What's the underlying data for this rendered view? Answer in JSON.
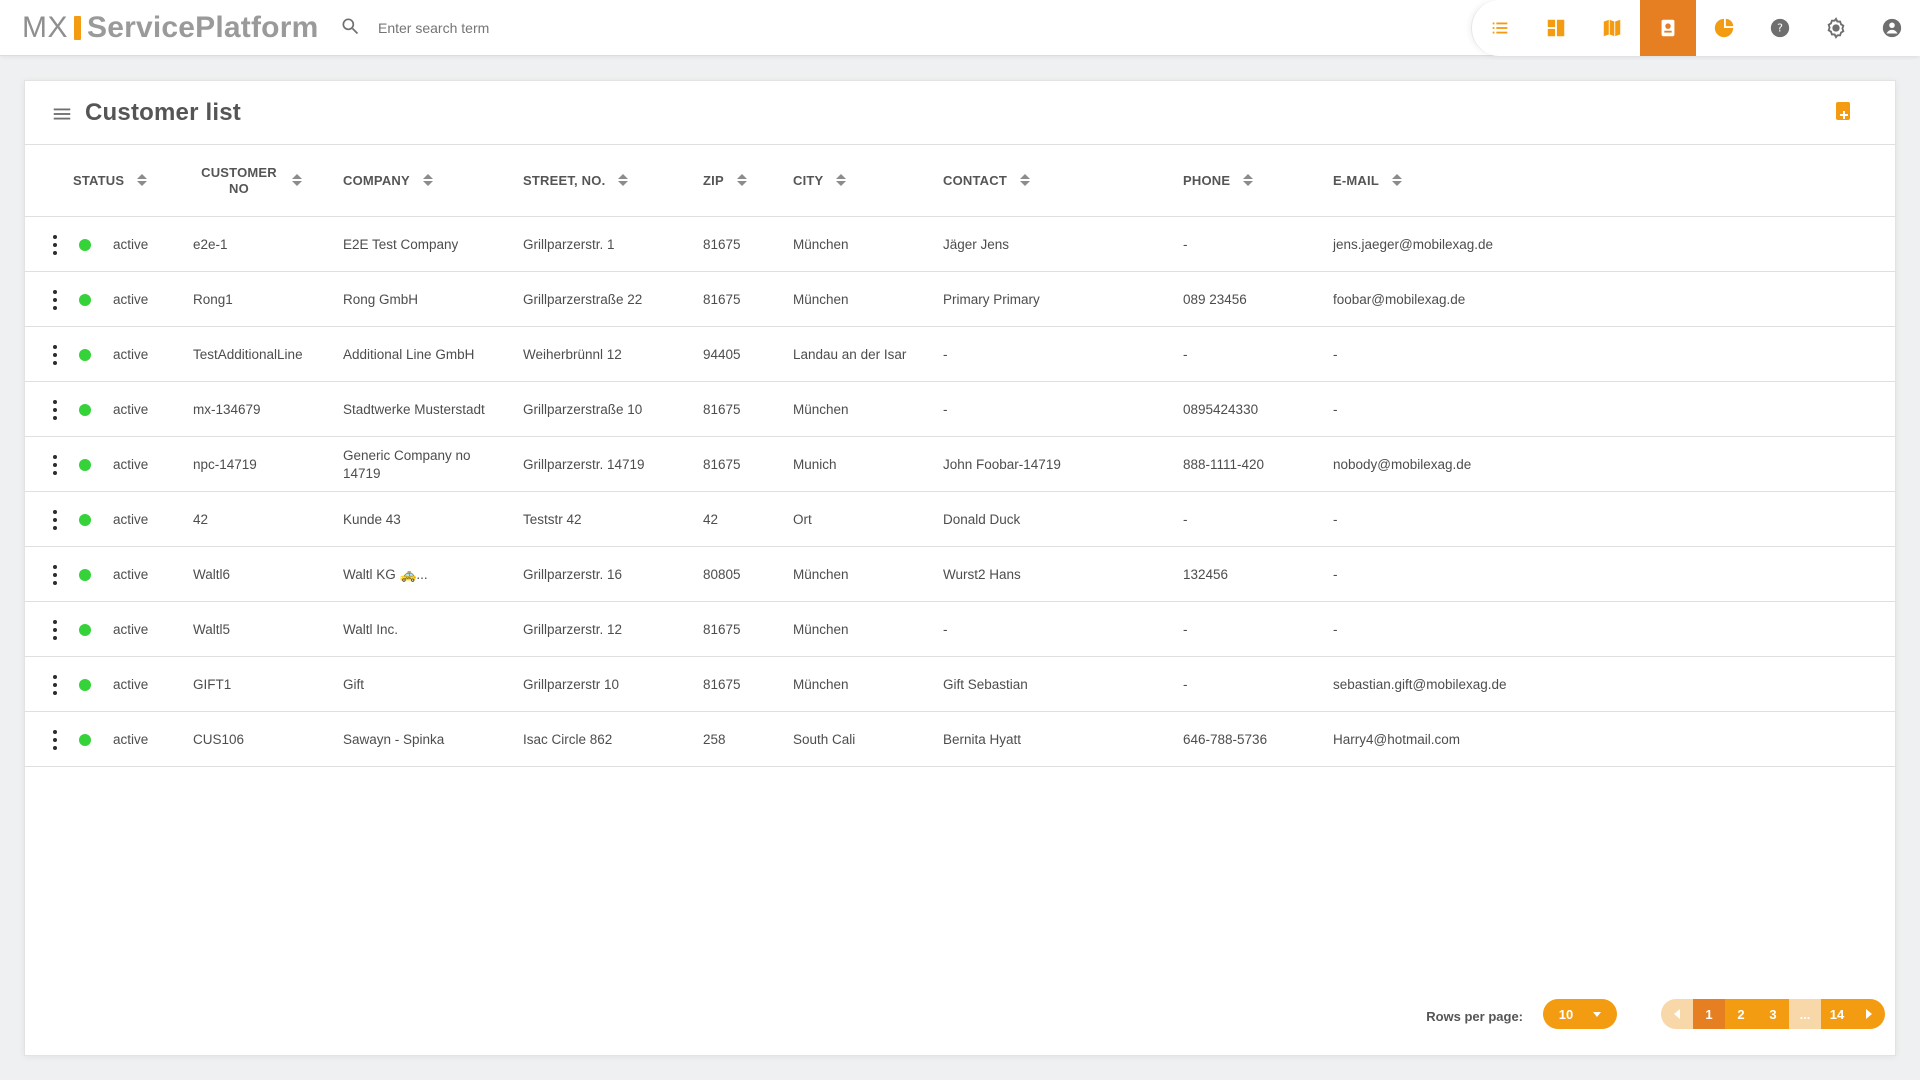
{
  "app": {
    "logo_mx": "MX",
    "logo_name": "ServicePlatform"
  },
  "search": {
    "placeholder": "Enter search term"
  },
  "toolbar": {
    "icons": [
      {
        "name": "list-icon",
        "color": "#F39C12"
      },
      {
        "name": "dashboard-icon",
        "color": "#F39C12"
      },
      {
        "name": "map-icon",
        "color": "#F39C12"
      },
      {
        "name": "contact-card-icon",
        "color": "#FFFFFF",
        "active": true
      },
      {
        "name": "pie-chart-icon",
        "color": "#F39C12"
      },
      {
        "name": "help-icon",
        "color": "#6F6F6F"
      },
      {
        "name": "settings-icon",
        "color": "#6F6F6F"
      },
      {
        "name": "account-icon",
        "color": "#6F6F6F"
      }
    ]
  },
  "page": {
    "title": "Customer list"
  },
  "table": {
    "columns": [
      {
        "key": "status",
        "label": "STATUS"
      },
      {
        "key": "customer_no",
        "label": "CUSTOMER NO"
      },
      {
        "key": "company",
        "label": "COMPANY"
      },
      {
        "key": "street",
        "label": "STREET, NO."
      },
      {
        "key": "zip",
        "label": "ZIP"
      },
      {
        "key": "city",
        "label": "CITY"
      },
      {
        "key": "contact",
        "label": "CONTACT"
      },
      {
        "key": "phone",
        "label": "PHONE"
      },
      {
        "key": "email",
        "label": "E-MAIL"
      }
    ],
    "rows": [
      {
        "status": "active",
        "customer_no": "e2e-1",
        "company": "E2E Test Company",
        "street": "Grillparzerstr. 1",
        "zip": "81675",
        "city": "München",
        "contact": "Jäger Jens",
        "phone": "-",
        "email": "jens.jaeger@mobilexag.de"
      },
      {
        "status": "active",
        "customer_no": "Rong1",
        "company": "Rong GmbH",
        "street": "Grillparzerstraße 22",
        "zip": "81675",
        "city": "München",
        "contact": "Primary Primary",
        "phone": "089 23456",
        "email": "foobar@mobilexag.de"
      },
      {
        "status": "active",
        "customer_no": "TestAdditionalLine",
        "company": "Additional Line GmbH",
        "street": "Weiherbrünnl 12",
        "zip": "94405",
        "city": "Landau an der Isar",
        "contact": "-",
        "phone": "-",
        "email": "-"
      },
      {
        "status": "active",
        "customer_no": "mx-134679",
        "company": "Stadtwerke Musterstadt",
        "street": "Grillparzerstraße 10",
        "zip": "81675",
        "city": "München",
        "contact": "-",
        "phone": "0895424330",
        "email": "-"
      },
      {
        "status": "active",
        "customer_no": "npc-14719",
        "company": "Generic Company no 14719",
        "street": "Grillparzerstr. 14719",
        "zip": "81675",
        "city": "Munich",
        "contact": "John Foobar-14719",
        "phone": "888-1111-420",
        "email": "nobody@mobilexag.de"
      },
      {
        "status": "active",
        "customer_no": "42",
        "company": "Kunde 43",
        "street": "Teststr 42",
        "zip": "42",
        "city": "Ort",
        "contact": "Donald Duck",
        "phone": "-",
        "email": "-"
      },
      {
        "status": "active",
        "customer_no": "Waltl6",
        "company": "Waltl KG 🚕...",
        "street": "Grillparzerstr. 16",
        "zip": "80805",
        "city": "München",
        "contact": "Wurst2 Hans",
        "phone": "132456",
        "email": "-"
      },
      {
        "status": "active",
        "customer_no": "Waltl5",
        "company": "Waltl Inc.",
        "street": "Grillparzerstr. 12",
        "zip": "81675",
        "city": "München",
        "contact": "-",
        "phone": "-",
        "email": "-"
      },
      {
        "status": "active",
        "customer_no": "GIFT1",
        "company": "Gift",
        "street": "Grillparzerstr 10",
        "zip": "81675",
        "city": "München",
        "contact": "Gift Sebastian",
        "phone": "-",
        "email": "sebastian.gift@mobilexag.de"
      },
      {
        "status": "active",
        "customer_no": "CUS106",
        "company": "Sawayn - Spinka",
        "street": "Isac Circle 862",
        "zip": "258",
        "city": "South Cali",
        "contact": "Bernita Hyatt",
        "phone": "646-788-5736",
        "email": "Harry4@hotmail.com"
      }
    ]
  },
  "footer": {
    "rows_per_page_label": "Rows per page:",
    "rows_per_page_value": "10",
    "pagination": {
      "pages": [
        "1",
        "2",
        "3",
        "...",
        "14"
      ],
      "active": "1"
    }
  },
  "colors": {
    "accent": "#F39C12",
    "accent_dark": "#E67E22",
    "status_active": "#35D23A"
  }
}
